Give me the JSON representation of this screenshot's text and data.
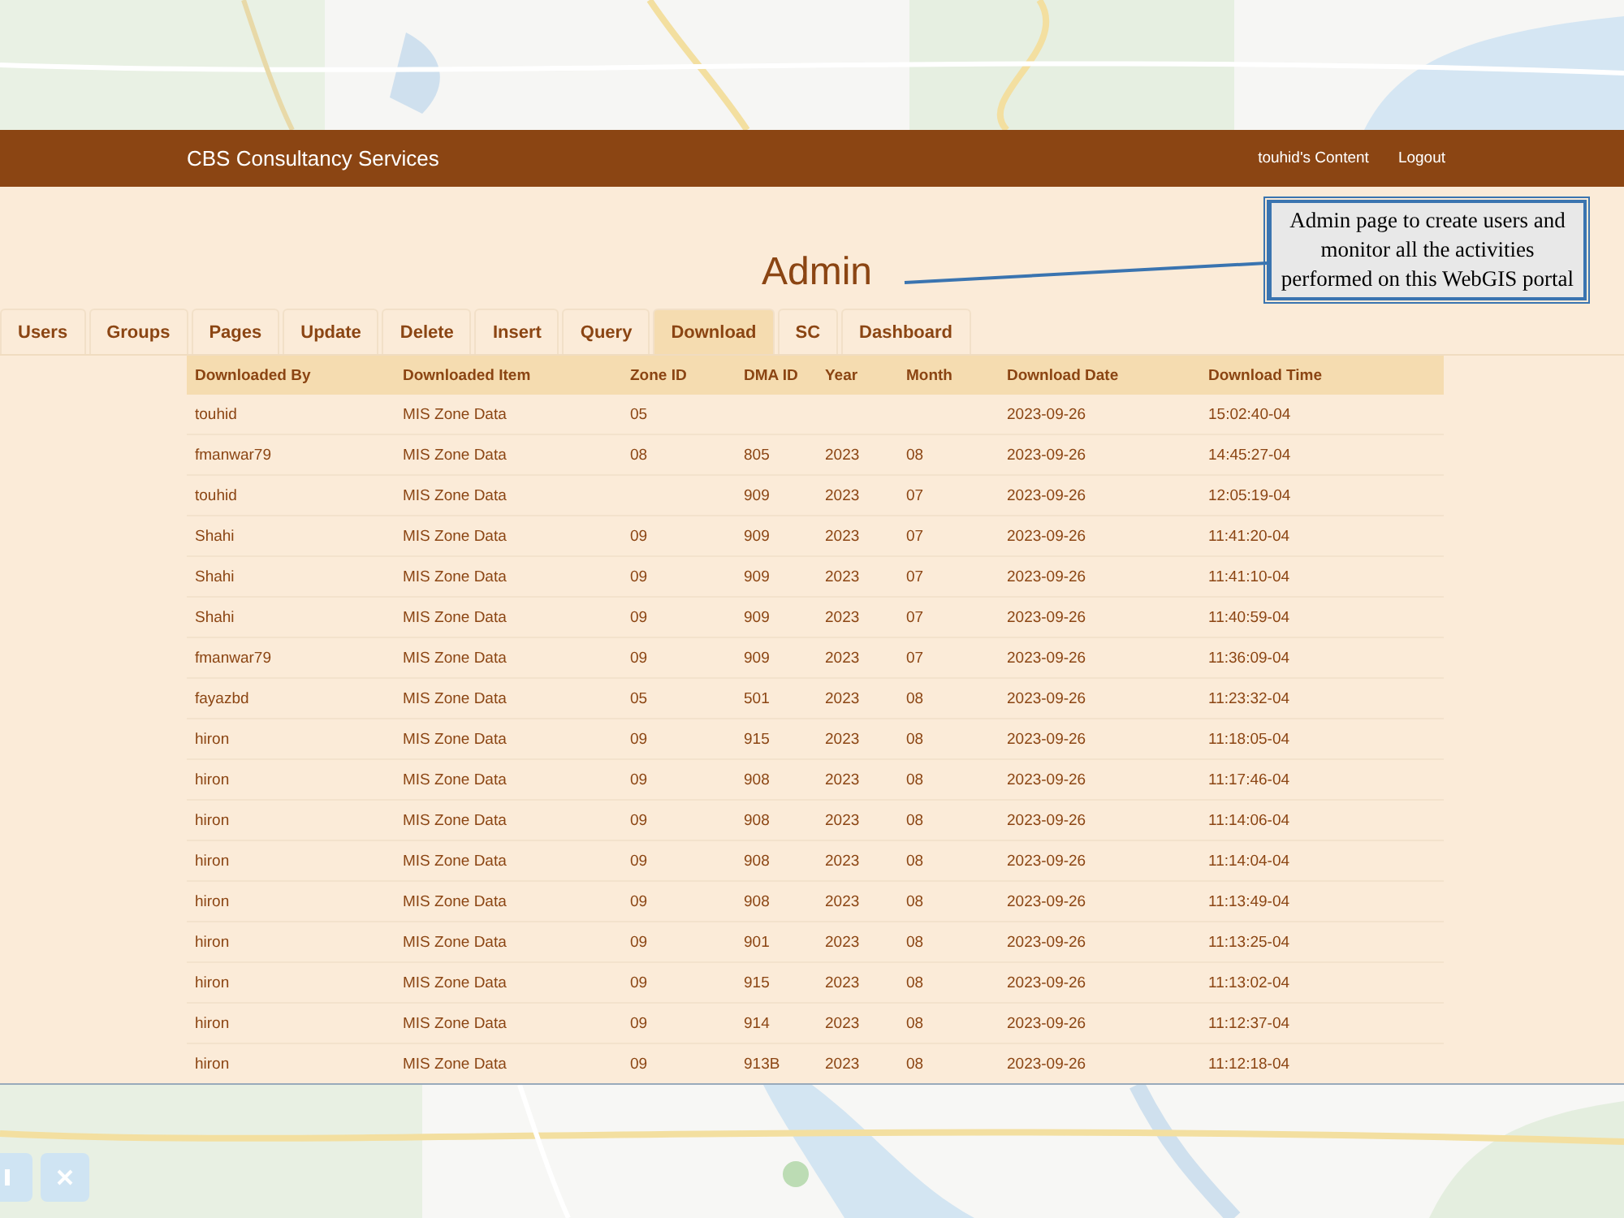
{
  "header": {
    "brand": "CBS Consultancy Services",
    "links": [
      "touhid's Content",
      "Logout"
    ]
  },
  "page_title": "Admin",
  "callout": {
    "text": "Admin page to create users and monitor all the activities performed on this WebGIS portal"
  },
  "tabs": [
    {
      "label": "Users",
      "selected": false
    },
    {
      "label": "Groups",
      "selected": false
    },
    {
      "label": "Pages",
      "selected": false
    },
    {
      "label": "Update",
      "selected": false
    },
    {
      "label": "Delete",
      "selected": false
    },
    {
      "label": "Insert",
      "selected": false
    },
    {
      "label": "Query",
      "selected": false
    },
    {
      "label": "Download",
      "selected": true
    },
    {
      "label": "SC",
      "selected": false
    },
    {
      "label": "Dashboard",
      "selected": false
    }
  ],
  "table": {
    "columns": [
      "Downloaded By",
      "Downloaded Item",
      "Zone ID",
      "DMA ID",
      "Year",
      "Month",
      "Download Date",
      "Download Time"
    ],
    "rows": [
      [
        "touhid",
        "MIS Zone Data",
        "05",
        "",
        "",
        "",
        "2023-09-26",
        "15:02:40-04"
      ],
      [
        "fmanwar79",
        "MIS Zone Data",
        "08",
        "805",
        "2023",
        "08",
        "2023-09-26",
        "14:45:27-04"
      ],
      [
        "touhid",
        "MIS Zone Data",
        "",
        "909",
        "2023",
        "07",
        "2023-09-26",
        "12:05:19-04"
      ],
      [
        "Shahi",
        "MIS Zone Data",
        "09",
        "909",
        "2023",
        "07",
        "2023-09-26",
        "11:41:20-04"
      ],
      [
        "Shahi",
        "MIS Zone Data",
        "09",
        "909",
        "2023",
        "07",
        "2023-09-26",
        "11:41:10-04"
      ],
      [
        "Shahi",
        "MIS Zone Data",
        "09",
        "909",
        "2023",
        "07",
        "2023-09-26",
        "11:40:59-04"
      ],
      [
        "fmanwar79",
        "MIS Zone Data",
        "09",
        "909",
        "2023",
        "07",
        "2023-09-26",
        "11:36:09-04"
      ],
      [
        "fayazbd",
        "MIS Zone Data",
        "05",
        "501",
        "2023",
        "08",
        "2023-09-26",
        "11:23:32-04"
      ],
      [
        "hiron",
        "MIS Zone Data",
        "09",
        "915",
        "2023",
        "08",
        "2023-09-26",
        "11:18:05-04"
      ],
      [
        "hiron",
        "MIS Zone Data",
        "09",
        "908",
        "2023",
        "08",
        "2023-09-26",
        "11:17:46-04"
      ],
      [
        "hiron",
        "MIS Zone Data",
        "09",
        "908",
        "2023",
        "08",
        "2023-09-26",
        "11:14:06-04"
      ],
      [
        "hiron",
        "MIS Zone Data",
        "09",
        "908",
        "2023",
        "08",
        "2023-09-26",
        "11:14:04-04"
      ],
      [
        "hiron",
        "MIS Zone Data",
        "09",
        "908",
        "2023",
        "08",
        "2023-09-26",
        "11:13:49-04"
      ],
      [
        "hiron",
        "MIS Zone Data",
        "09",
        "901",
        "2023",
        "08",
        "2023-09-26",
        "11:13:25-04"
      ],
      [
        "hiron",
        "MIS Zone Data",
        "09",
        "915",
        "2023",
        "08",
        "2023-09-26",
        "11:13:02-04"
      ],
      [
        "hiron",
        "MIS Zone Data",
        "09",
        "914",
        "2023",
        "08",
        "2023-09-26",
        "11:12:37-04"
      ],
      [
        "hiron",
        "MIS Zone Data",
        "09",
        "913B",
        "2023",
        "08",
        "2023-09-26",
        "11:12:18-04"
      ]
    ]
  }
}
